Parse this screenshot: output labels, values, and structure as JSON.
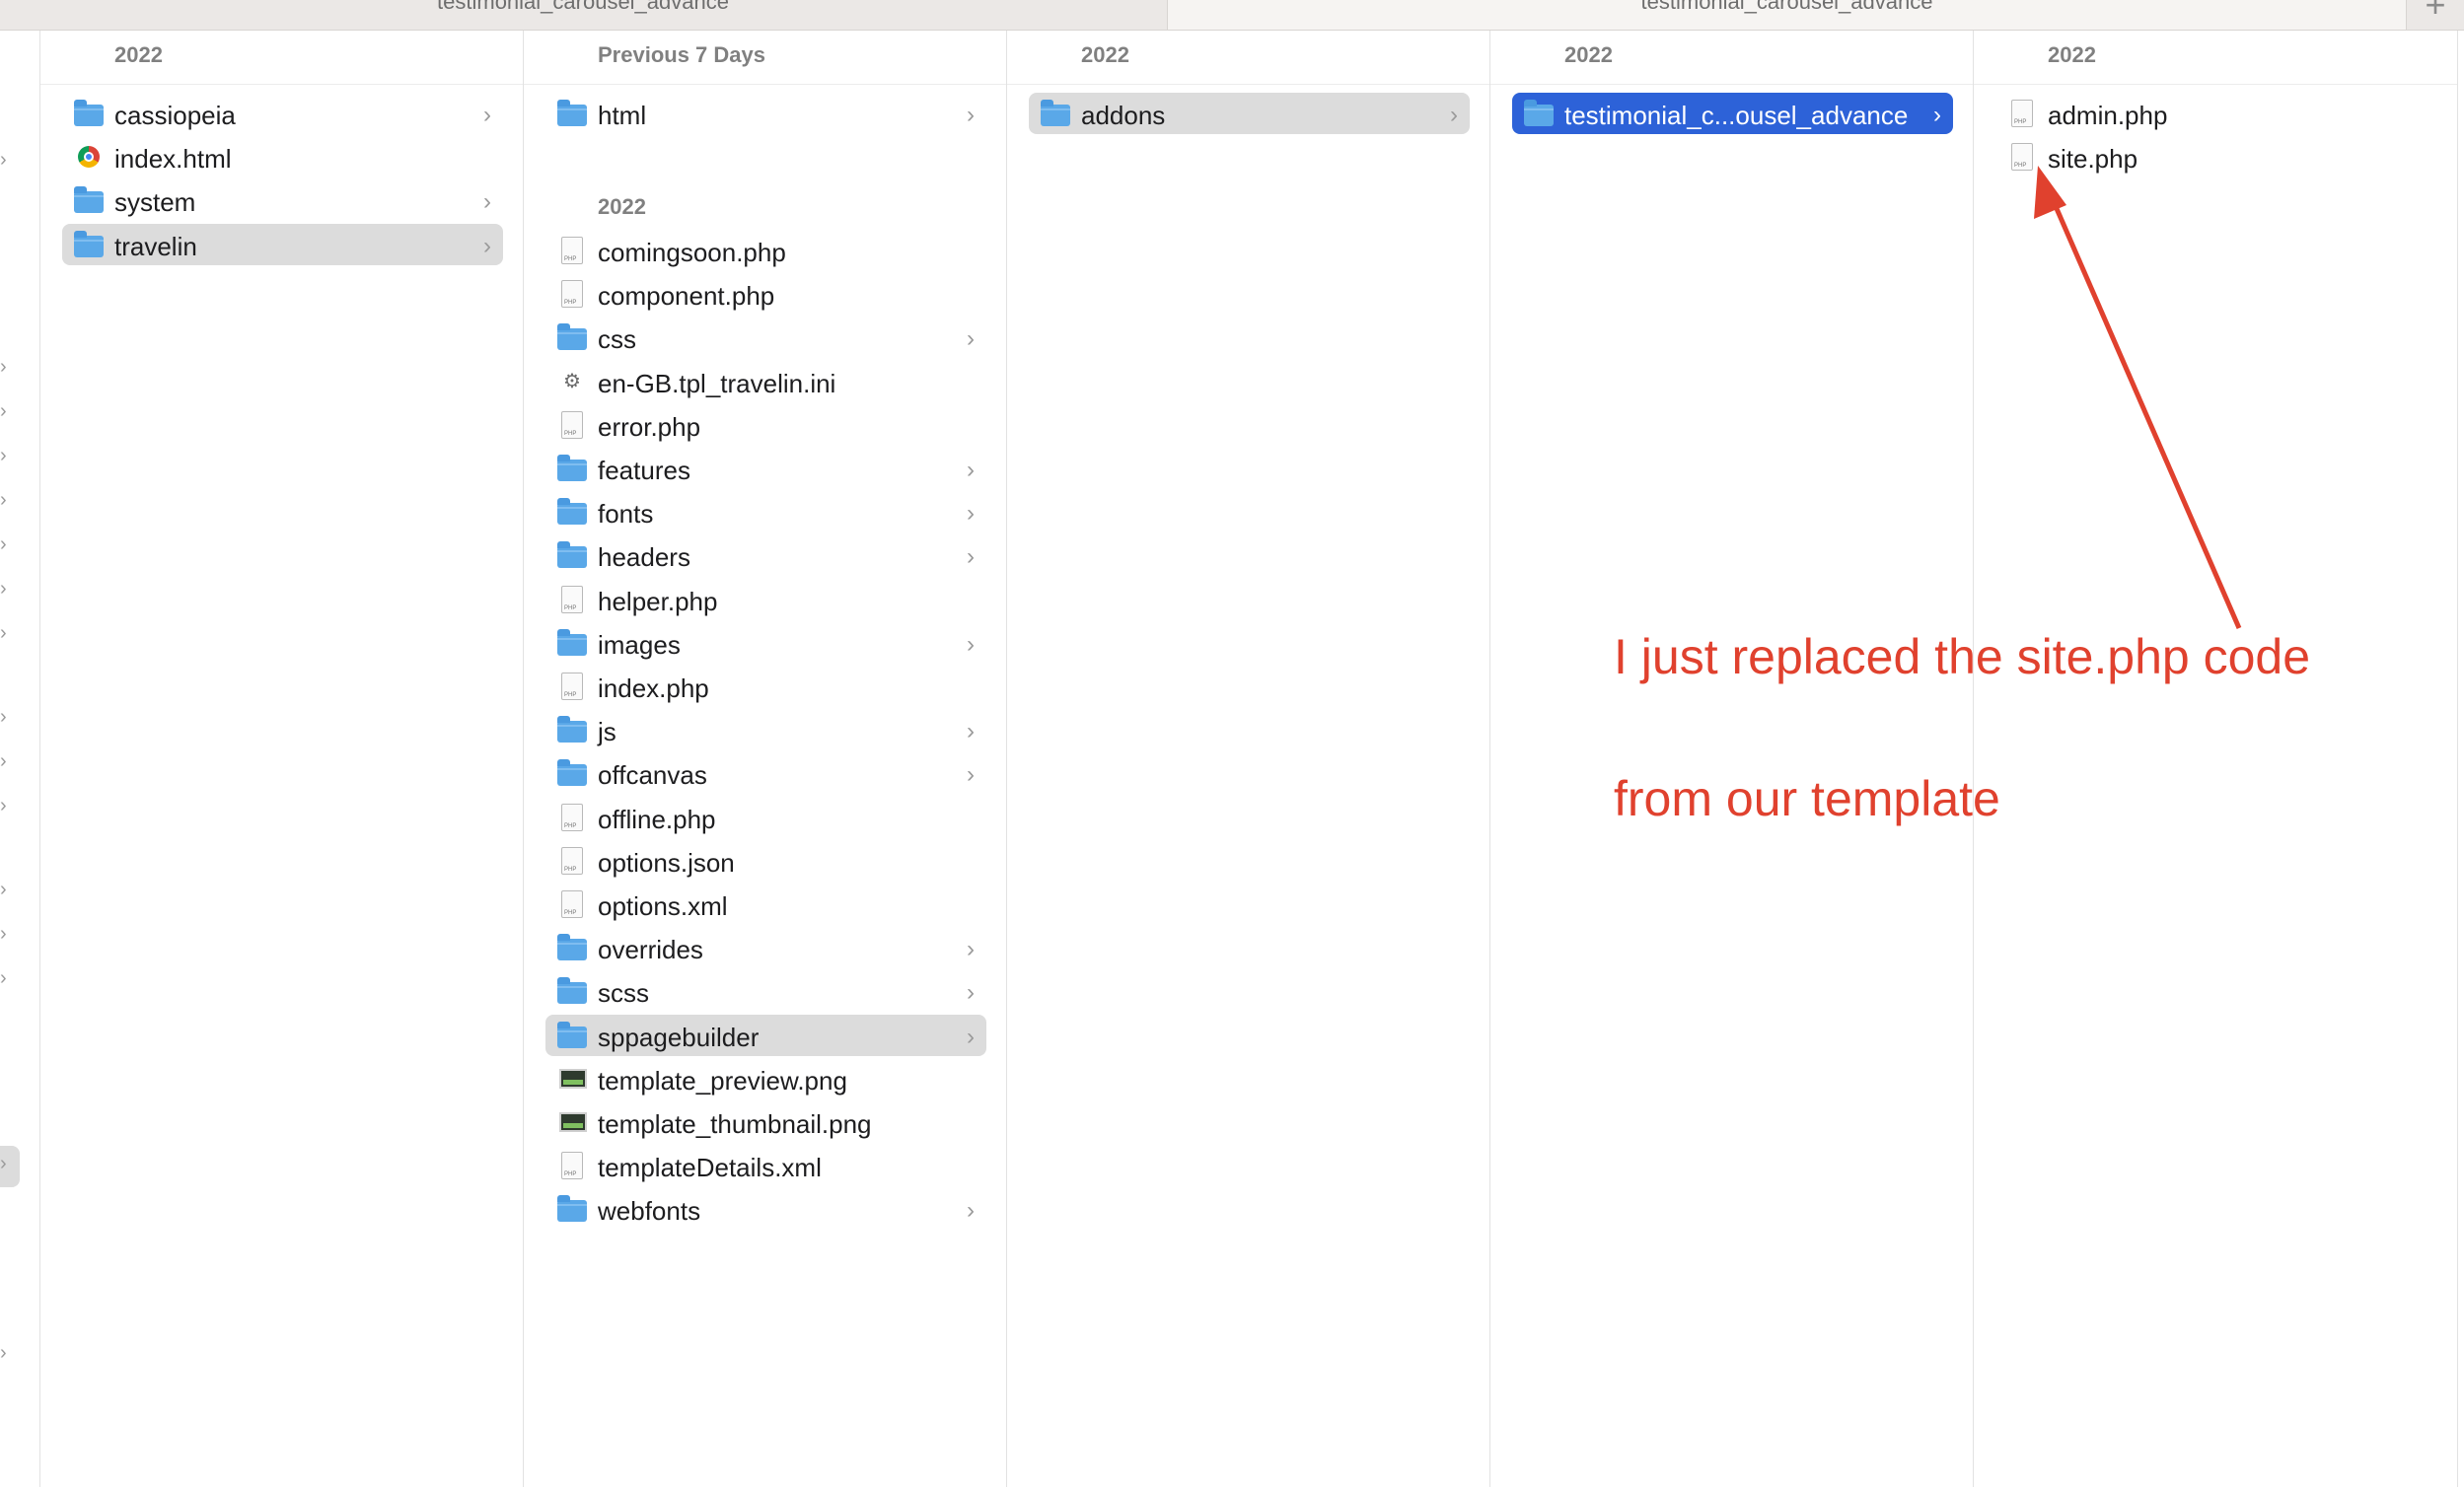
{
  "tabs": [
    {
      "label": "testimonial_carousel_advance"
    },
    {
      "label": "testimonial_carousel_advance"
    }
  ],
  "new_tab_label": "+",
  "columns": [
    {
      "header": "2022",
      "items": [
        {
          "name": "cassiopeia",
          "kind": "folder",
          "chevron": "›"
        },
        {
          "name": "index.html",
          "kind": "chrome-html"
        },
        {
          "name": "system",
          "kind": "folder",
          "chevron": "›"
        },
        {
          "name": "travelin",
          "kind": "folder",
          "chevron": "›",
          "selected": true
        }
      ]
    },
    {
      "header": "Previous 7 Days",
      "items_top": [
        {
          "name": "html",
          "kind": "folder",
          "chevron": "›"
        }
      ],
      "subheader": "2022",
      "items": [
        {
          "name": "comingsoon.php",
          "kind": "php"
        },
        {
          "name": "component.php",
          "kind": "php"
        },
        {
          "name": "css",
          "kind": "folder",
          "chevron": "›"
        },
        {
          "name": "en-GB.tpl_travelin.ini",
          "kind": "ini"
        },
        {
          "name": "error.php",
          "kind": "php"
        },
        {
          "name": "features",
          "kind": "folder",
          "chevron": "›"
        },
        {
          "name": "fonts",
          "kind": "folder",
          "chevron": "›"
        },
        {
          "name": "headers",
          "kind": "folder",
          "chevron": "›"
        },
        {
          "name": "helper.php",
          "kind": "php"
        },
        {
          "name": "images",
          "kind": "folder",
          "chevron": "›"
        },
        {
          "name": "index.php",
          "kind": "php"
        },
        {
          "name": "js",
          "kind": "folder",
          "chevron": "›"
        },
        {
          "name": "offcanvas",
          "kind": "folder",
          "chevron": "›"
        },
        {
          "name": "offline.php",
          "kind": "php"
        },
        {
          "name": "options.json",
          "kind": "json"
        },
        {
          "name": "options.xml",
          "kind": "xml"
        },
        {
          "name": "overrides",
          "kind": "folder",
          "chevron": "›"
        },
        {
          "name": "scss",
          "kind": "folder",
          "chevron": "›"
        },
        {
          "name": "sppagebuilder",
          "kind": "folder",
          "chevron": "›",
          "selected": true
        },
        {
          "name": "template_preview.png",
          "kind": "png"
        },
        {
          "name": "template_thumbnail.png",
          "kind": "png"
        },
        {
          "name": "templateDetails.xml",
          "kind": "xml"
        },
        {
          "name": "webfonts",
          "kind": "folder",
          "chevron": "›"
        }
      ]
    },
    {
      "header": "2022",
      "items": [
        {
          "name": "addons",
          "kind": "folder",
          "chevron": "›",
          "selected": true
        }
      ]
    },
    {
      "header": "2022",
      "items": [
        {
          "name": "testimonial_c...ousel_advance",
          "kind": "folder",
          "chevron": "›",
          "active": true
        }
      ]
    },
    {
      "header": "2022",
      "items": [
        {
          "name": "admin.php",
          "kind": "php"
        },
        {
          "name": "site.php",
          "kind": "php"
        }
      ]
    }
  ],
  "edge_chevron": "›",
  "annotation": {
    "line1": "I just replaced the site.php code",
    "line2": "from our template",
    "color": "#e0412e"
  },
  "colors": {
    "accent": "#2d62d8",
    "selection": "#dcdcdc",
    "folder": "#5aa8e8"
  }
}
